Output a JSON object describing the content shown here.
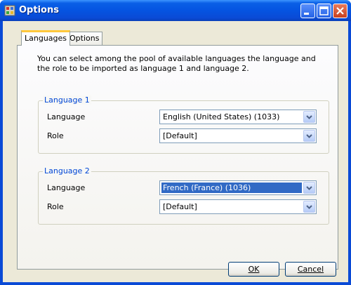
{
  "window": {
    "title": "Options"
  },
  "tabs": [
    {
      "label": "Languages",
      "active": true
    },
    {
      "label": "Options",
      "active": false
    }
  ],
  "intro_text": "You can select among the pool of available languages the language and the role to be imported as language 1 and language 2.",
  "groups": [
    {
      "title": "Language 1",
      "language_label": "Language",
      "language_value": "English (United States) (1033)",
      "role_label": "Role",
      "role_value": "[Default]"
    },
    {
      "title": "Language 2",
      "language_label": "Language",
      "language_value": "French (France) (1036)",
      "role_label": "Role",
      "role_value": "[Default]"
    }
  ],
  "buttons": {
    "ok": "OK",
    "cancel": "Cancel"
  },
  "icons": {
    "title": "options-app-icon",
    "minimize": "minimize-icon",
    "maximize": "maximize-icon",
    "close": "close-icon",
    "dropdown": "chevron-down-icon"
  },
  "colors": {
    "titlebar": "#0a4ad6",
    "dialog_bg": "#ece9d8",
    "group_title": "#0046d5",
    "selection": "#316ac5",
    "active_tab_accent": "#ffc83c"
  }
}
